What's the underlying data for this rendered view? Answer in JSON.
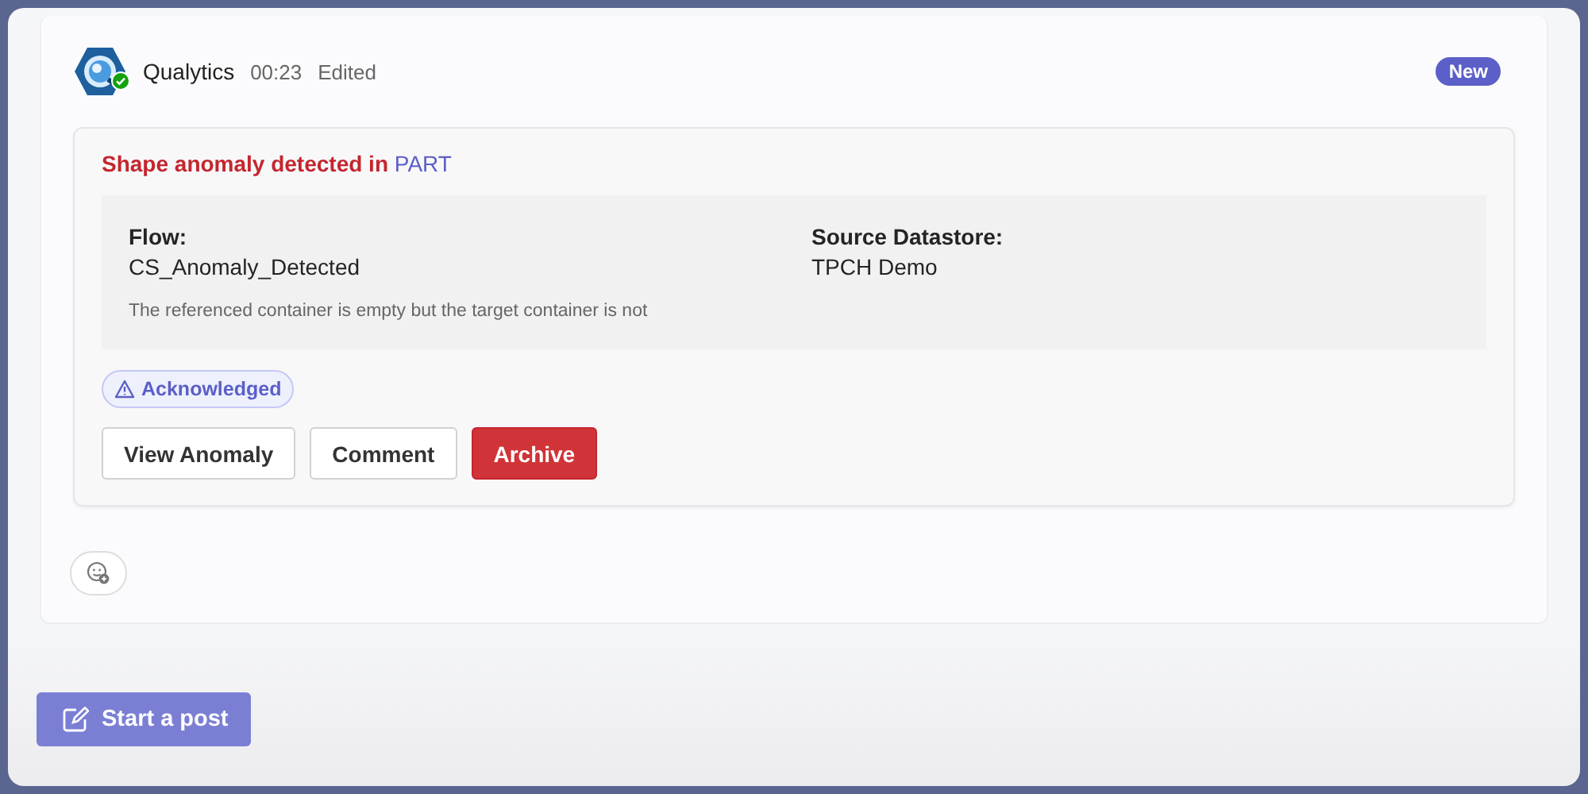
{
  "post": {
    "author": "Qualytics",
    "author_verified": true,
    "time": "00:23",
    "edited_label": "Edited",
    "badge": "New",
    "alert": {
      "title": "Shape anomaly detected in ",
      "target": "PART",
      "fields": [
        {
          "label": "Flow:",
          "value": "CS_Anomaly_Detected"
        },
        {
          "label": "Source Datastore:",
          "value": "TPCH Demo"
        }
      ],
      "description": "The referenced container is empty but the target container is not",
      "status": "Acknowledged",
      "buttons": [
        {
          "label": "View Anomaly",
          "kind": "secondary"
        },
        {
          "label": "Comment",
          "kind": "secondary"
        },
        {
          "label": "Archive",
          "kind": "danger"
        }
      ]
    }
  },
  "composer": {
    "button": "Start a post"
  }
}
